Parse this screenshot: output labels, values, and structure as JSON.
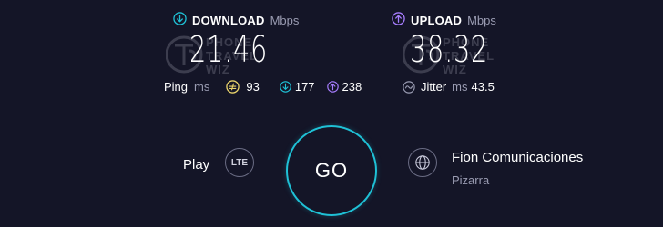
{
  "download": {
    "label": "DOWNLOAD",
    "unit": "Mbps",
    "value": "21.46"
  },
  "upload": {
    "label": "UPLOAD",
    "unit": "Mbps",
    "value": "38.32"
  },
  "ping": {
    "label": "Ping",
    "unit": "ms",
    "idle": "93",
    "down": "177",
    "up": "238"
  },
  "jitter": {
    "label": "Jitter",
    "unit": "ms",
    "value": "43.5"
  },
  "watermark": {
    "line1": "PHONE",
    "line2": "TRAVEL",
    "line3": "WIZ"
  },
  "go_button": {
    "label": "GO"
  },
  "network": {
    "name": "Play",
    "type": "LTE"
  },
  "provider": {
    "name": "Fion Comunicaciones",
    "location": "Pizarra"
  },
  "colors": {
    "background": "#141527",
    "download_accent": "#1fc1d6",
    "upload_accent": "#a77dff",
    "ping_idle": "#e8d26a",
    "go_ring": "#1fc1d6"
  },
  "icons": {
    "download": "download-arrow-icon",
    "upload": "upload-arrow-icon",
    "ping_idle": "ping-idle-icon",
    "jitter": "jitter-wave-icon",
    "server": "globe-icon"
  }
}
